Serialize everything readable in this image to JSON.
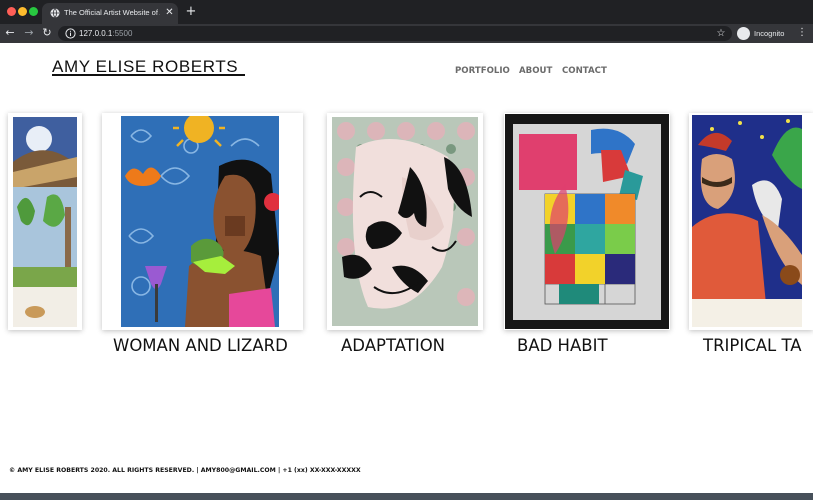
{
  "browser": {
    "tab_title": "The Official Artist Website of Amy Elise Roberts",
    "url_host": "127.0.0.1",
    "url_port": ":5500",
    "incognito_label": "Incognito"
  },
  "site": {
    "logo": "AMY ELISE ROBERTS",
    "nav": [
      "PORTFOLIO",
      "ABOUT",
      "CONTACT"
    ]
  },
  "gallery": [
    {
      "title": "WOMAN AND LIZARD"
    },
    {
      "title": "ADAPTATION"
    },
    {
      "title": "BAD HABIT"
    },
    {
      "title": "TRIPICAL TA"
    }
  ],
  "footer": {
    "text": "© AMY ELISE ROBERTS 2020. ALL RIGHTS RESERVED. | AMY800@GMAIL.COM | +1 (xx) XX-XXX-XXXXX"
  },
  "colors": {
    "browser_dark": "#202124",
    "toolbar": "#35363a",
    "nav_gray": "#6b6b6b"
  }
}
